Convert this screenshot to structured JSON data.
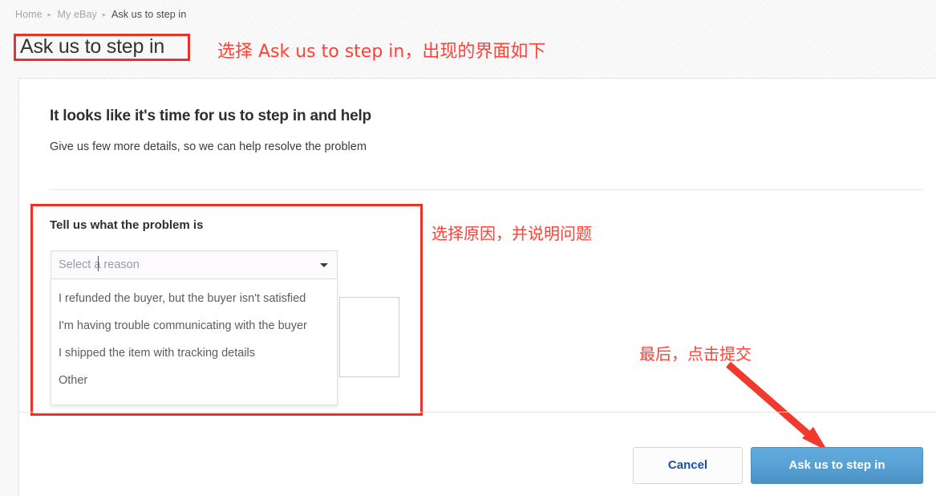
{
  "breadcrumb": {
    "items": [
      {
        "label": "Home",
        "current": false
      },
      {
        "label": "My eBay",
        "current": false
      },
      {
        "label": "Ask us to step in",
        "current": true
      }
    ],
    "separator": "▸"
  },
  "page": {
    "title": "Ask us to step in"
  },
  "annotations": {
    "top": "选择 Ask us to step in，出现的界面如下",
    "reason": "选择原因，并说明问题",
    "submit": "最后，点击提交",
    "color": "#ff4136",
    "box_color": "#ee3124"
  },
  "main": {
    "heading": "It looks like it's time for us to step in and help",
    "subheading": "Give us few more details, so we can help resolve the problem",
    "problem": {
      "label": "Tell us what the problem is",
      "select": {
        "placeholder": "Select a reason",
        "value": "",
        "caret_icon": "chevron-down-icon",
        "expanded": true,
        "options": [
          "I refunded the buyer, but the buyer isn't satisfied",
          "I'm having trouble communicating with the buyer",
          "I shipped the item with tracking details",
          "Other"
        ]
      },
      "details_textarea": {
        "value": "",
        "placeholder": ""
      }
    }
  },
  "footer": {
    "cancel_label": "Cancel",
    "submit_label": "Ask us to step in",
    "cancel_color": "#1b4fa8",
    "submit_color": "#5aa3d6"
  }
}
